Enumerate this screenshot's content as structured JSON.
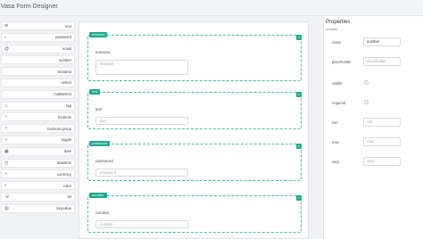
{
  "app": {
    "title": "Vasa Form Designer"
  },
  "sidebar": {
    "items": [
      {
        "label": "text",
        "icon": "text-icon",
        "glyph": "⊕"
      },
      {
        "label": "password",
        "icon": "key-icon",
        "glyph": "⌐"
      },
      {
        "label": "email",
        "icon": "at-icon",
        "glyph": "@"
      },
      {
        "label": "number",
        "icon": "hash-icon",
        "glyph": ""
      },
      {
        "label": "textarea",
        "icon": "textarea-icon",
        "glyph": ""
      },
      {
        "label": "select",
        "icon": "select-icon",
        "glyph": ""
      },
      {
        "label": "multiselect",
        "icon": "multiselect-icon",
        "glyph": ""
      },
      {
        "label": "tag",
        "icon": "tag-icon",
        "glyph": "◇"
      },
      {
        "label": "boolean",
        "icon": "check-icon",
        "glyph": "✓"
      },
      {
        "label": "boolean group",
        "icon": "check-group-icon",
        "glyph": "✓"
      },
      {
        "label": "toggle",
        "icon": "toggle-icon",
        "glyph": "✓"
      },
      {
        "label": "date",
        "icon": "calendar-icon",
        "glyph": "▣"
      },
      {
        "label": "datetime",
        "icon": "clock-icon",
        "glyph": "◷"
      },
      {
        "label": "currency",
        "icon": "currency-icon",
        "glyph": "◑"
      },
      {
        "label": "color",
        "icon": "color-icon",
        "glyph": "◐"
      },
      {
        "label": "tel",
        "icon": "phone-icon",
        "glyph": "☏"
      },
      {
        "label": "keyvalue",
        "icon": "keyvalue-icon",
        "glyph": "▤"
      }
    ]
  },
  "canvas": {
    "fields": [
      {
        "tag": "textarea",
        "label": "textarea",
        "placeholder": "textarea",
        "kind": "area",
        "corner": "x"
      },
      {
        "tag": "text",
        "label": "text",
        "placeholder": "text",
        "kind": "line",
        "corner": "x"
      },
      {
        "tag": "password",
        "label": "password",
        "placeholder": "password",
        "kind": "line",
        "corner": "x"
      },
      {
        "tag": "number",
        "label": "number",
        "placeholder": "number",
        "kind": "line",
        "corner": "x"
      }
    ]
  },
  "properties": {
    "title": "Properties",
    "subtitle": "number",
    "rows": [
      {
        "label": "name",
        "value": "number",
        "type": "input"
      },
      {
        "label": "placeholder",
        "value": "placeholder",
        "type": "input-ph"
      },
      {
        "label": "visible",
        "value": "",
        "type": "radio"
      },
      {
        "label": "required",
        "value": "",
        "type": "radio"
      },
      {
        "label": "min",
        "value": "min",
        "type": "input-ph"
      },
      {
        "label": "max",
        "value": "max",
        "type": "input-ph"
      },
      {
        "label": "step",
        "value": "step",
        "type": "input-ph"
      }
    ]
  },
  "colors": {
    "accent": "#1bab8c",
    "accent_border": "#3bbfa3"
  }
}
